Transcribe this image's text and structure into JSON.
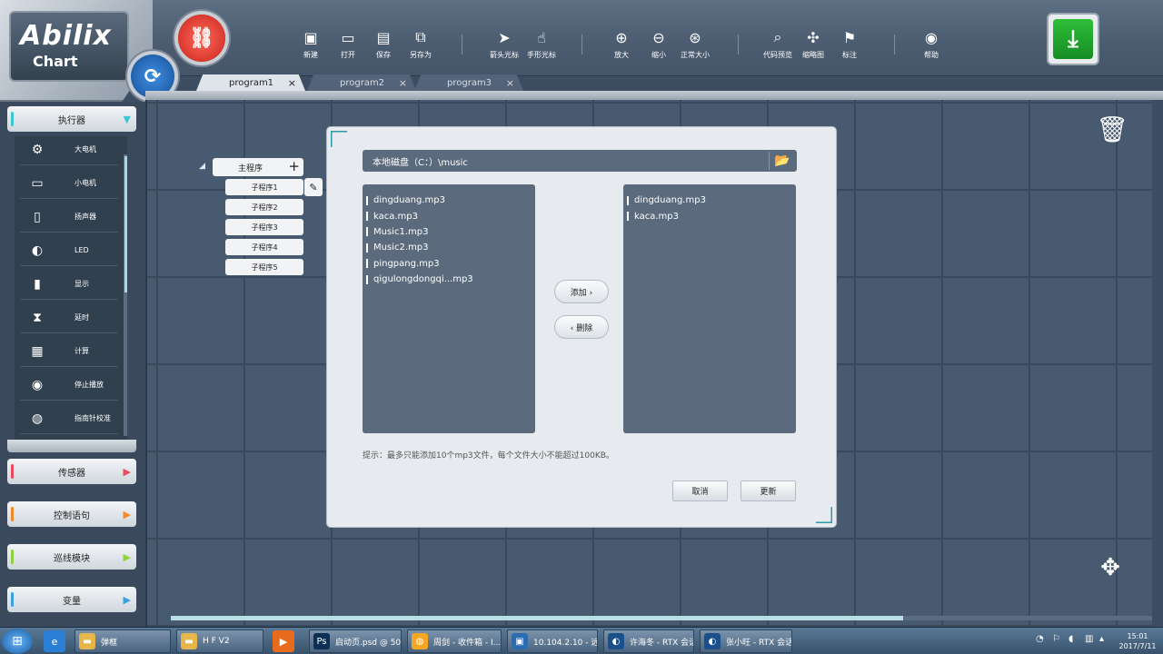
{
  "app": {
    "logo_text": "Abilix",
    "logo_sub": "Chart"
  },
  "toolbar": {
    "items": [
      {
        "label": "新建",
        "icon": "new-file-icon",
        "glyph": "▣"
      },
      {
        "label": "打开",
        "icon": "open-folder-icon",
        "glyph": "▭"
      },
      {
        "label": "保存",
        "icon": "save-icon",
        "glyph": "▤"
      },
      {
        "label": "另存为",
        "icon": "save-as-icon",
        "glyph": "⧉"
      },
      {
        "label": "箭头光标",
        "icon": "arrow-cursor-icon",
        "glyph": "➤"
      },
      {
        "label": "手形光标",
        "icon": "hand-cursor-icon",
        "glyph": "☝"
      },
      {
        "label": "放大",
        "icon": "zoom-in-icon",
        "glyph": "⊕"
      },
      {
        "label": "缩小",
        "icon": "zoom-out-icon",
        "glyph": "⊖"
      },
      {
        "label": "正常大小",
        "icon": "zoom-reset-icon",
        "glyph": "⊛"
      },
      {
        "label": "代码预览",
        "icon": "code-preview-icon",
        "glyph": "⌕"
      },
      {
        "label": "缩略图",
        "icon": "thumbnail-icon",
        "glyph": "✣"
      },
      {
        "label": "标注",
        "icon": "annotate-icon",
        "glyph": "⚑"
      },
      {
        "label": "帮助",
        "icon": "help-icon",
        "glyph": "◉"
      }
    ]
  },
  "tabs": [
    {
      "label": "program1",
      "active": true
    },
    {
      "label": "program2",
      "active": false
    },
    {
      "label": "program3",
      "active": false
    }
  ],
  "tab_close": "×",
  "sidebar": {
    "categories": [
      {
        "label": "执行器",
        "color": "#3fc6d3"
      },
      {
        "label": "传感器",
        "color": "#e84a5f"
      },
      {
        "label": "控制语句",
        "color": "#f08a2a"
      },
      {
        "label": "巡线模块",
        "color": "#8fd13f"
      },
      {
        "label": "变量",
        "color": "#3aa0e0"
      }
    ],
    "blocks": [
      {
        "label": "大电机",
        "icon": "large-motor-icon",
        "glyph": "⚙"
      },
      {
        "label": "小电机",
        "icon": "small-motor-icon",
        "glyph": "▭"
      },
      {
        "label": "扬声器",
        "icon": "speaker-icon",
        "glyph": "▯"
      },
      {
        "label": "LED",
        "icon": "led-icon",
        "glyph": "◐"
      },
      {
        "label": "显示",
        "icon": "display-icon",
        "glyph": "▮"
      },
      {
        "label": "延时",
        "icon": "hourglass-icon",
        "glyph": "⧗"
      },
      {
        "label": "计算",
        "icon": "calculator-icon",
        "glyph": "▦"
      },
      {
        "label": "停止播放",
        "icon": "stop-play-icon",
        "glyph": "◉"
      },
      {
        "label": "指南针校准",
        "icon": "compass-icon",
        "glyph": "◍"
      }
    ]
  },
  "program_tree": {
    "main": "主程序",
    "plus": "+",
    "subs": [
      "子程序1",
      "子程序2",
      "子程序3",
      "子程序4",
      "子程序5"
    ]
  },
  "dialog": {
    "path": "本地磁盘（C：）\\music",
    "left_files": [
      "dingduang.mp3",
      "kaca.mp3",
      "Music1.mp3",
      "Music2.mp3",
      "pingpang.mp3",
      "qigulongdongqi...mp3"
    ],
    "right_files": [
      "dingduang.mp3",
      "kaca.mp3"
    ],
    "add_label": "添加 ›",
    "remove_label": "‹ 删除",
    "hint": "提示：最多只能添加10个mp3文件，每个文件大小不能超过100KB。",
    "cancel_label": "取消",
    "update_label": "更新"
  },
  "taskbar": {
    "tasks": [
      {
        "label": "弹框",
        "color": "#e6b64a",
        "glyph": "▬"
      },
      {
        "label": "H F  V2",
        "color": "#e6b64a",
        "glyph": "▬"
      },
      {
        "label": "启动页.psd @ 50...",
        "color": "#0c2f54",
        "glyph": "Ps"
      },
      {
        "label": "周剑 - 收件箱 - I...",
        "color": "#f5a623",
        "glyph": "◍"
      },
      {
        "label": "10.104.2.10 - 远...",
        "color": "#2b6cb0",
        "glyph": "▣"
      },
      {
        "label": "许海冬 - RTX 会话",
        "color": "#1b4f8a",
        "glyph": "◐"
      },
      {
        "label": "张小旺 - RTX 会话",
        "color": "#1b4f8a",
        "glyph": "◐"
      }
    ],
    "time": "15:01",
    "date": "2017/7/11"
  }
}
